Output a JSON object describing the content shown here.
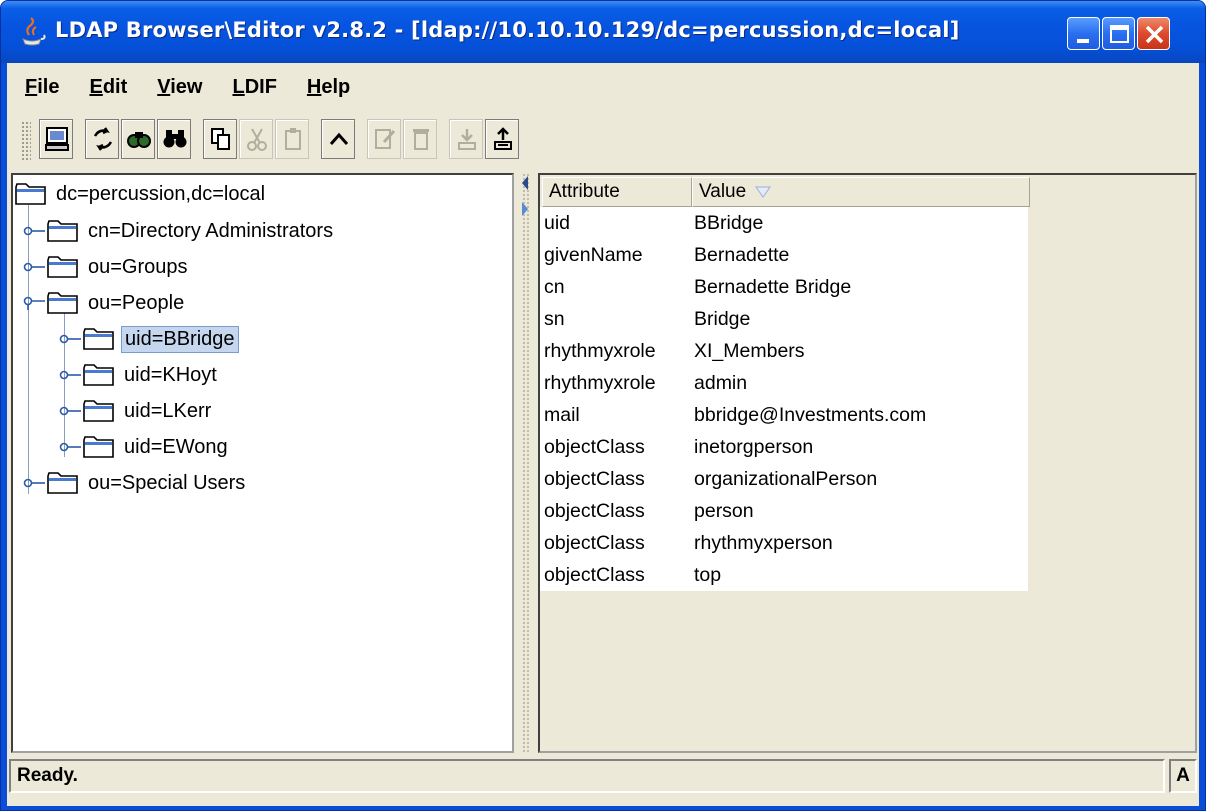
{
  "window": {
    "title": "LDAP Browser\\Editor v2.8.2 - [ldap://10.10.10.129/dc=percussion,dc=local]",
    "controls": {
      "minimize": "minimize-icon",
      "maximize": "maximize-icon",
      "close": "close-icon"
    }
  },
  "menu": [
    {
      "first": "F",
      "rest": "ile"
    },
    {
      "first": "E",
      "rest": "dit"
    },
    {
      "first": "V",
      "rest": "iew"
    },
    {
      "first": "L",
      "rest": "DIF"
    },
    {
      "first": "H",
      "rest": "elp"
    }
  ],
  "toolbar": [
    {
      "icon": "computer-icon",
      "enabled": true
    },
    {
      "icon": "refresh-icon",
      "enabled": true
    },
    {
      "icon": "search-icon",
      "enabled": true
    },
    {
      "icon": "binoculars-icon",
      "enabled": true
    },
    {
      "icon": "copy-icon",
      "enabled": true
    },
    {
      "icon": "cut-icon",
      "enabled": false
    },
    {
      "icon": "paste-icon",
      "enabled": false
    },
    {
      "icon": "up-icon",
      "enabled": true
    },
    {
      "icon": "edit-icon",
      "enabled": false
    },
    {
      "icon": "delete-icon",
      "enabled": false
    },
    {
      "icon": "import-icon",
      "enabled": false
    },
    {
      "icon": "export-icon",
      "enabled": true
    }
  ],
  "tree": {
    "root": "dc=percussion,dc=local",
    "nodes": [
      {
        "label": "cn=Directory Administrators",
        "depth": 1,
        "expanded": false
      },
      {
        "label": "ou=Groups",
        "depth": 1,
        "expanded": false
      },
      {
        "label": "ou=People",
        "depth": 1,
        "expanded": true
      },
      {
        "label": "uid=BBridge",
        "depth": 2,
        "expanded": false,
        "selected": true
      },
      {
        "label": "uid=KHoyt",
        "depth": 2,
        "expanded": false
      },
      {
        "label": "uid=LKerr",
        "depth": 2,
        "expanded": false
      },
      {
        "label": "uid=EWong",
        "depth": 2,
        "expanded": false
      },
      {
        "label": "ou=Special Users",
        "depth": 1,
        "expanded": false
      }
    ]
  },
  "table": {
    "columns": [
      "Attribute",
      "Value"
    ],
    "sort_icon": "sort-descending-icon",
    "rows": [
      [
        "uid",
        "BBridge"
      ],
      [
        "givenName",
        "Bernadette"
      ],
      [
        "cn",
        "Bernadette Bridge"
      ],
      [
        "sn",
        "Bridge"
      ],
      [
        "rhythmyxrole",
        "XI_Members"
      ],
      [
        "rhythmyxrole",
        "admin"
      ],
      [
        "mail",
        "bbridge@Investments.com"
      ],
      [
        "objectClass",
        "inetorgperson"
      ],
      [
        "objectClass",
        "organizationalPerson"
      ],
      [
        "objectClass",
        "person"
      ],
      [
        "objectClass",
        "rhythmyxperson"
      ],
      [
        "objectClass",
        "top"
      ]
    ]
  },
  "status": {
    "message": "Ready.",
    "mode": "A"
  }
}
